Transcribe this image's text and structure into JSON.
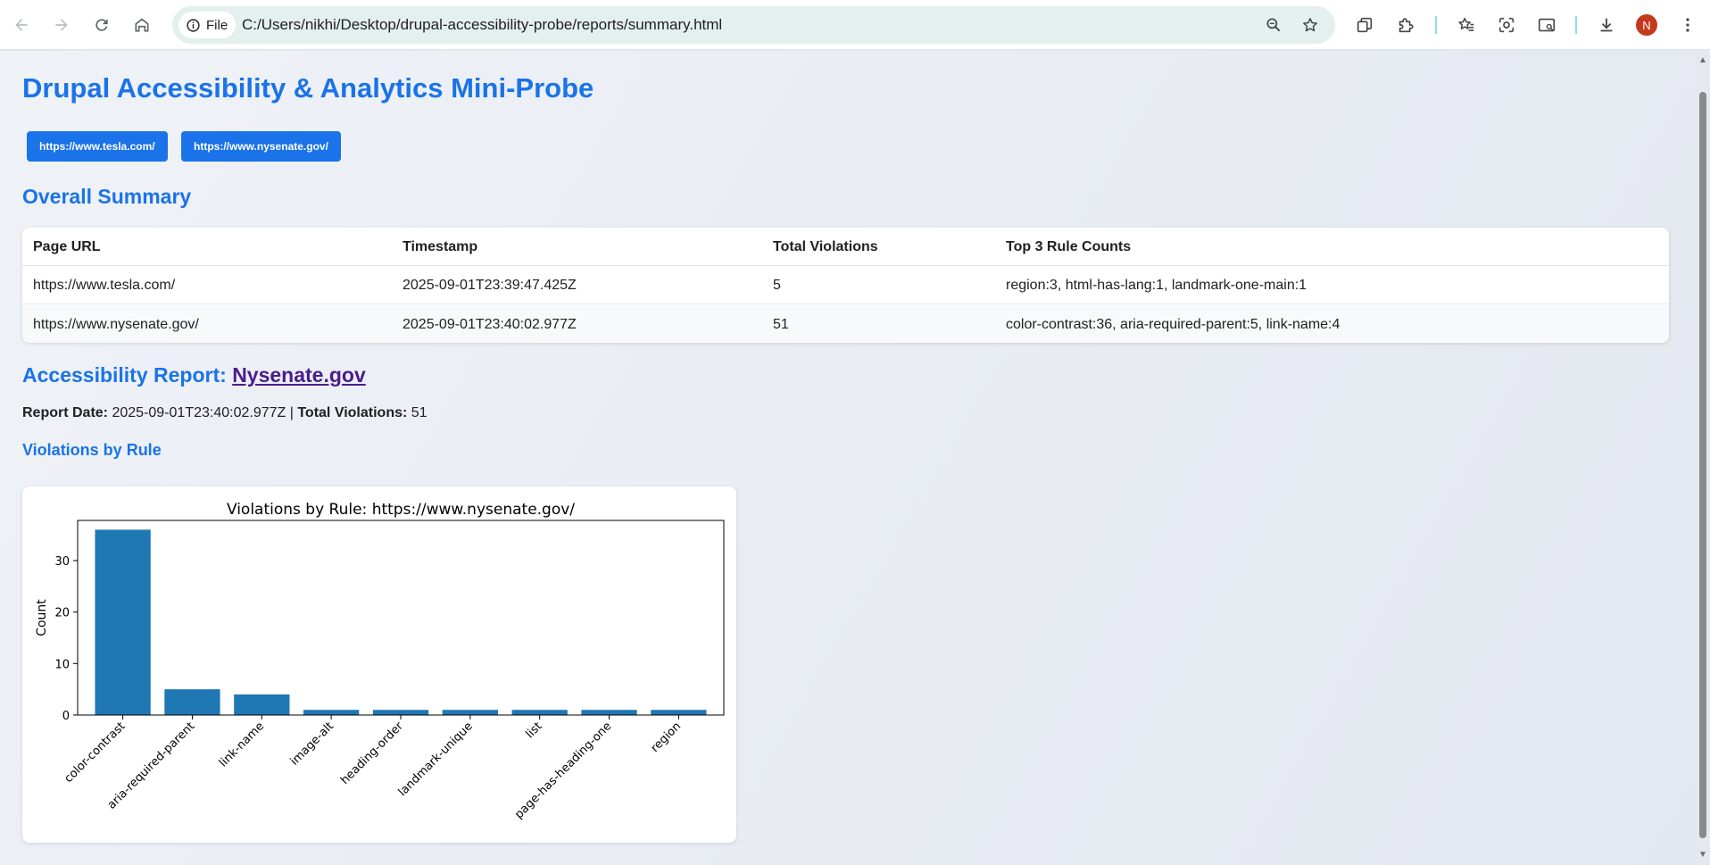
{
  "browser": {
    "file_chip": "File",
    "address": "C:/Users/nikhi/Desktop/drupal-accessibility-probe/reports/summary.html",
    "avatar_initial": "N"
  },
  "page": {
    "title": "Drupal Accessibility & Analytics Mini-Probe",
    "url_buttons": [
      "https://www.tesla.com/",
      "https://www.nysenate.gov/"
    ],
    "summary_heading": "Overall Summary",
    "table": {
      "headers": [
        "Page URL",
        "Timestamp",
        "Total Violations",
        "Top 3 Rule Counts"
      ],
      "rows": [
        [
          "https://www.tesla.com/",
          "2025-09-01T23:39:47.425Z",
          "5",
          "region:3, html-has-lang:1, landmark-one-main:1"
        ],
        [
          "https://www.nysenate.gov/",
          "2025-09-01T23:40:02.977Z",
          "51",
          "color-contrast:36, aria-required-parent:5, link-name:4"
        ]
      ]
    },
    "report_heading_prefix": "Accessibility Report:",
    "report_heading_link": "Nysenate.gov",
    "report_date_label": "Report Date:",
    "report_date": "2025-09-01T23:40:02.977Z",
    "separator": "|",
    "total_label": "Total Violations:",
    "total_value": "51",
    "chart_heading": "Violations by Rule"
  },
  "chart_data": {
    "type": "bar",
    "title": "Violations by Rule: https://www.nysenate.gov/",
    "xlabel": "",
    "ylabel": "Count",
    "categories": [
      "color-contrast",
      "aria-required-parent",
      "link-name",
      "image-alt",
      "heading-order",
      "landmark-unique",
      "list",
      "page-has-heading-one",
      "region"
    ],
    "values": [
      36,
      5,
      4,
      1,
      1,
      1,
      1,
      1,
      1
    ],
    "yticks": [
      0,
      10,
      20,
      30
    ],
    "ylim": [
      0,
      37.8
    ],
    "bar_color": "#1f77b4",
    "grid": false
  },
  "icons": {
    "back": "back-arrow-icon",
    "forward": "forward-arrow-icon",
    "reload": "reload-icon",
    "home": "home-icon",
    "info": "info-icon",
    "zoom": "zoom-icon",
    "bookmark": "star-icon",
    "tab_search": "tab-groups-icon",
    "extensions": "puzzle-icon",
    "reading_list": "star-list-icon",
    "lens": "lens-icon",
    "search_page": "search-page-icon",
    "downloads": "download-icon",
    "menu": "more-vert-icon"
  },
  "colors": {
    "accent": "#1a73e8",
    "link_visited": "#4a1d8c",
    "omnibox": "#e3f0ed",
    "avatar": "#c5391d"
  }
}
